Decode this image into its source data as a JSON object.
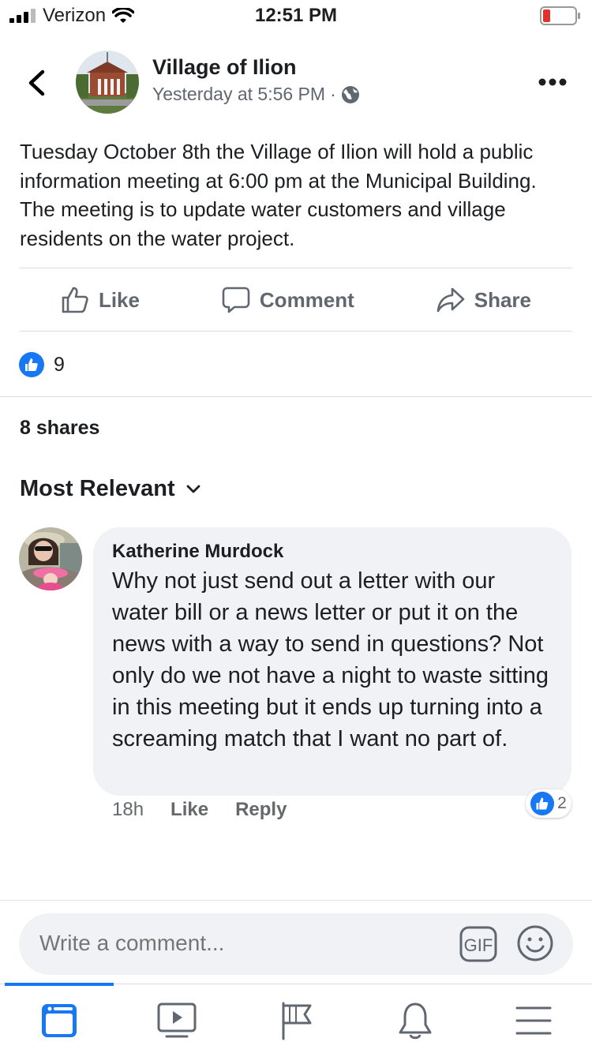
{
  "status_bar": {
    "carrier": "Verizon",
    "time": "12:51 PM"
  },
  "post": {
    "page_name": "Village of Ilion",
    "timestamp": "Yesterday at 5:56 PM",
    "separator": "·",
    "text": "Tuesday October 8th the Village of Ilion will hold a public information meeting at 6:00 pm at the Municipal Building. The meeting is to update water customers and village residents on the water project.",
    "actions": {
      "like": "Like",
      "comment": "Comment",
      "share": "Share"
    },
    "like_count": "9",
    "shares": "8 shares"
  },
  "comments": {
    "sort_label": "Most Relevant",
    "items": [
      {
        "author": "Katherine Murdock",
        "text": "Why not just send out a letter with our water bill or a news letter or put it on the news with a way to send in questions? Not only do we not have a night to waste sitting in this meeting but it ends up turning into a screaming match that I want no part of.",
        "time": "18h",
        "like": "Like",
        "reply": "Reply",
        "like_count": "2"
      }
    ]
  },
  "composer": {
    "placeholder": "Write a comment...",
    "gif_label": "GIF"
  },
  "tabs": [
    "news-feed-icon",
    "watch-icon",
    "pages-icon",
    "notifications-icon",
    "menu-icon"
  ],
  "colors": {
    "accent": "#1877f2",
    "muted": "#606770",
    "bubble": "#f0f2f5",
    "battery_low": "#e0322d"
  }
}
